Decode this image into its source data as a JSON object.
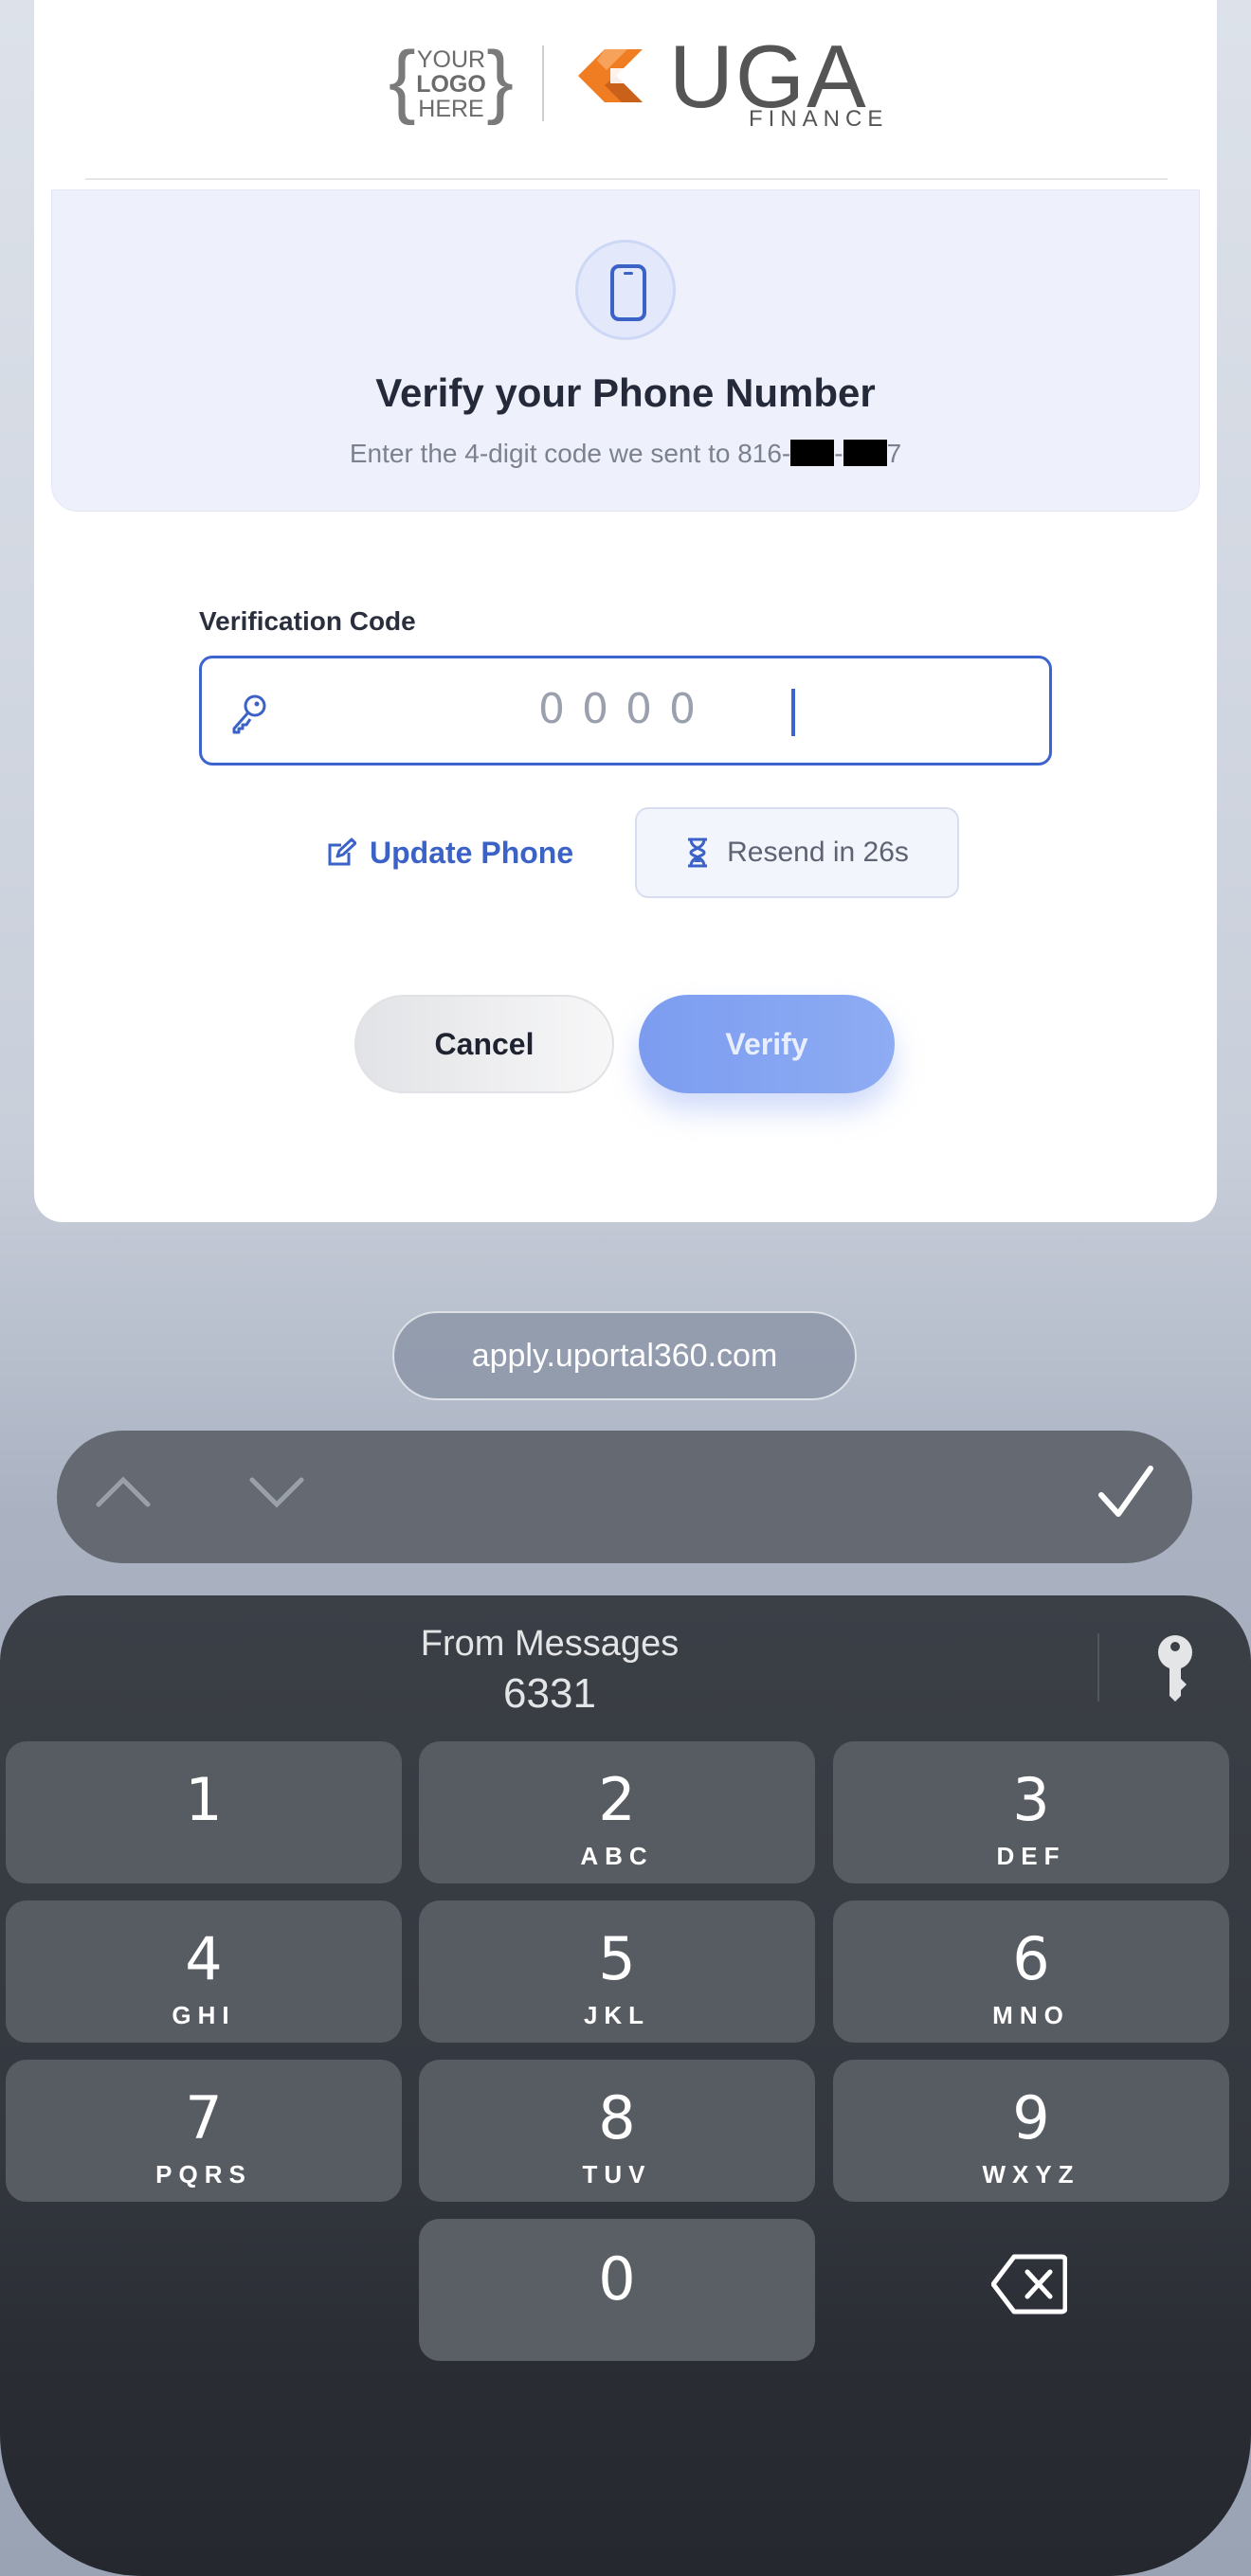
{
  "logo": {
    "placeholder_lines": [
      "YOUR",
      "LOGO",
      "HERE"
    ],
    "brand_word": "UGA",
    "brand_sub": "FINANCE",
    "brand_color": "#f07d22"
  },
  "verify": {
    "title": "Verify your Phone Number",
    "subtitle_prefix": "Enter the 4-digit code we sent to 816-",
    "subtitle_mid": "-",
    "subtitle_suffix": "7",
    "icon": "smartphone-icon"
  },
  "form": {
    "label": "Verification Code",
    "code_value": "0000",
    "input_icon": "key-icon"
  },
  "actions": {
    "update_phone": "Update Phone",
    "resend": "Resend in 26s",
    "cancel": "Cancel",
    "verify": "Verify"
  },
  "browser": {
    "url": "apply.uportal360.com"
  },
  "keyboard": {
    "suggestion_source": "From Messages",
    "suggestion_code": "6331",
    "keys": [
      {
        "num": "1",
        "letters": ""
      },
      {
        "num": "2",
        "letters": "ABC"
      },
      {
        "num": "3",
        "letters": "DEF"
      },
      {
        "num": "4",
        "letters": "GHI"
      },
      {
        "num": "5",
        "letters": "JKL"
      },
      {
        "num": "6",
        "letters": "MNO"
      },
      {
        "num": "7",
        "letters": "PQRS"
      },
      {
        "num": "8",
        "letters": "TUV"
      },
      {
        "num": "9",
        "letters": "WXYZ"
      },
      {
        "num": "0",
        "letters": ""
      }
    ]
  },
  "colors": {
    "accent": "#3d63cf",
    "verify_button": "#7c9cf0",
    "keyboard_bg": "#33373e",
    "key_bg": "#575b62"
  }
}
